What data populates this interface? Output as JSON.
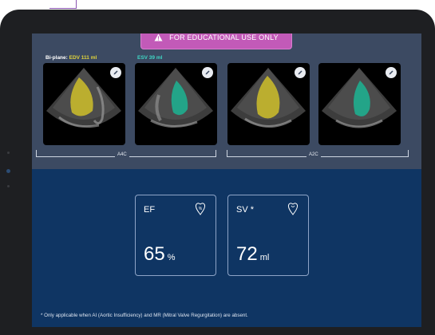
{
  "banner": {
    "text": "FOR EDUCATIONAL USE ONLY",
    "icon": "warning-icon",
    "color": "#c25ab8"
  },
  "volumes": {
    "prefix": "Bi-plane:",
    "edv": "EDV 111 ml",
    "esv": "ESV 39 ml",
    "edv_color": "#e0d33b",
    "esv_color": "#3fd6c4"
  },
  "clips": [
    {
      "view": "A4C",
      "phase": "EDV",
      "overlay_color": "#c8b92c"
    },
    {
      "view": "A4C",
      "phase": "ESV",
      "overlay_color": "#1fae8f"
    },
    {
      "view": "A2C",
      "phase": "EDV",
      "overlay_color": "#c8b92c"
    },
    {
      "view": "A2C",
      "phase": "ESV",
      "overlay_color": "#1fae8f"
    }
  ],
  "brackets": {
    "a4c": "A4C",
    "a2c": "A2C"
  },
  "metrics": [
    {
      "label": "EF",
      "value": "65",
      "unit": "%",
      "icon": "heart-percent-icon"
    },
    {
      "label": "SV *",
      "value": "72",
      "unit": "ml",
      "icon": "heart-icon"
    }
  ],
  "footnote": "* Only applicable when AI (Aortic Insufficiency) and MR (Mitral Valve Regurgitation) are absent."
}
